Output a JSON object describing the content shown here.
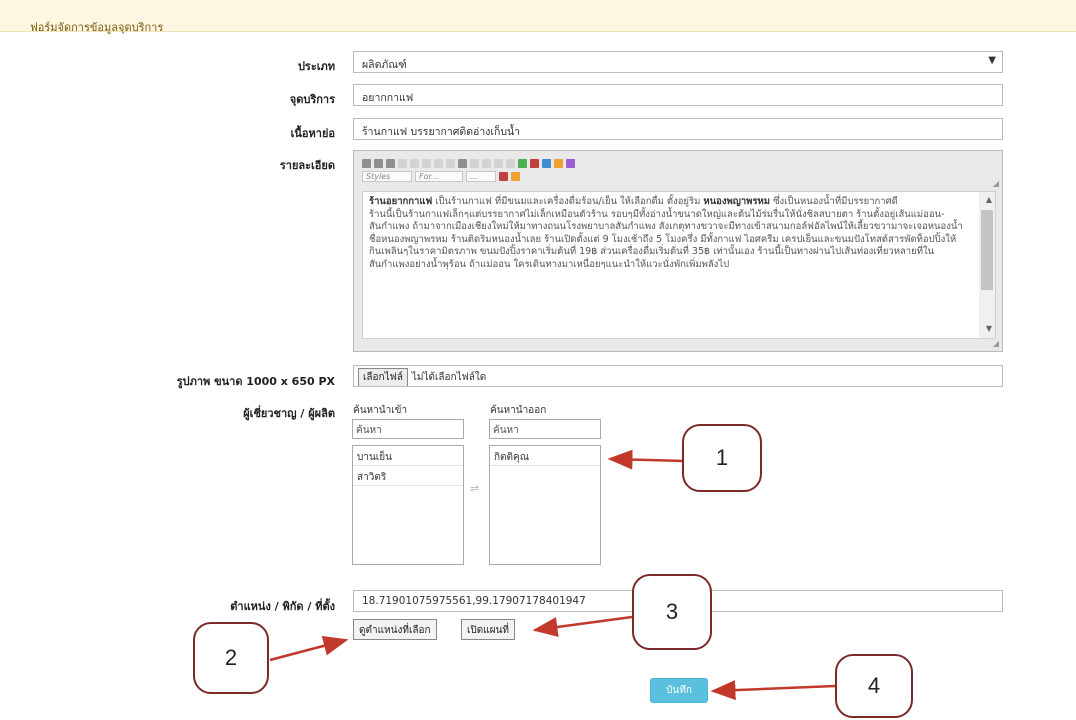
{
  "form": {
    "title": "ฟอร์มจัดการข้อมูลจุดบริการ",
    "type_label": "ประเภท",
    "type_value": "ผลิตภัณฑ์",
    "service_label": "จุดบริการ",
    "service_value": "อยากกาแฟ",
    "summary_label": "เนื้อหาย่อ",
    "summary_value": "ร้านกาแฟ บรรยากาศติดอ่างเก็บน้ำ",
    "detail_label": "รายละเอียด",
    "image_label": "รูปภาพ ขนาด 1000 x 650 PX",
    "expert_label": "ผู้เชี่ยวชาญ / ผู้ผลิต",
    "location_label": "ตำแหน่ง / พิกัด / ที่ตั้ง",
    "location_value": "18.71901075975561,99.17907178401947"
  },
  "editor": {
    "toolbar_row1": "B I U abc | ≡ ≡ | ≡ ≡ ” | ≡ ≡ ≡ ≡ | ▣ ● ▦ ● Ω",
    "styles_combo": "Styles",
    "font_combo": "For...",
    "size_combo": "...",
    "bold_1": "ร้านอยากกาแฟ",
    "text_1": " เป็นร้านกาแฟ ที่มีขนมและเครื่องดื่มร้อน/เย็น ให้เลือกดื่ม ตั้งอยู่ริม ",
    "bold_2": "หนองพญาพรหม",
    "text_2": " ซึ่งเป็นหนองน้ำที่มีบรรยากาศดี",
    "line_2": "ร้านนี้เป็นร้านกาแฟเล็กๆแต่บรรยากาศไม่เล็กเหมือนตัวร้าน รอบๆมีทั้งอ่างน้ำขนาดใหญ่และต้นไม้ร่มรื่นให้นั่งชิลสบายตา ร้านตั้งอยู่เส้นแม่ออน-สันกำแพง ถ้ามาจากเมืองเชียงใหม่ให้มาทางถนนโรงพยาบาลสันกำแพง สังเกตุทางขวาจะมีทางเข้าสนามกอล์ฟอัลไพน์ให้เลี้ยวขวามาจะเจอหนองน้ำชื่อหนองพญาพรหม ร้านติดริมหนองน้ำเลย ร้านเปิดตั้งแต่ 9 โมงเช้าถึง 5 โมงครึ่ง มีทั้งกาแฟ ไอศครีม เครปเย็นและขนมปังโทสต์สารพัดท็อปปิ้งให้กินเพลินๆในราคามิตรภาพ ขนมปังปิ้งราคาเริ่มต้นที่ 19฿ ส่วนเครื่องดื่มเริ่มต้นที่ 35฿ เท่านั้นเอง ร้านนี้เป็นทางผ่านไปเส้นท่องเที่ยวหลายที่ในสันกำแพงอย่างน้ำพุร้อน ถ้าแม่ออน ใครเดินทางมาเหนื่อยๆแนะนำให้แวะนั่งพักเพิ่มพลังไป"
  },
  "file": {
    "button": "เลือกไฟล์",
    "status": "ไม่ได้เลือกไฟล์ใด"
  },
  "multiselect": {
    "left_caption": "ค้นหานำเข้า",
    "right_caption": "ค้นหานำออก",
    "left_placeholder": "ค้นหา",
    "right_placeholder": "ค้นหา",
    "left_items": [
      "บานเย็น",
      "สาวิตริ"
    ],
    "right_items": [
      "กิตติคุณ"
    ],
    "transfer_icon": "⇌"
  },
  "buttons": {
    "view_selected": "ดูตำแหน่งที่เลือก",
    "open_map": "เปิดแผนที่",
    "save": "บันทึก"
  },
  "callouts": [
    "1",
    "2",
    "3",
    "4"
  ],
  "colors": {
    "header_bg": "#fdf6e0",
    "save_btn": "#5bc0de",
    "callout_border": "#7b2a2a",
    "arrow": "#c0392b"
  }
}
